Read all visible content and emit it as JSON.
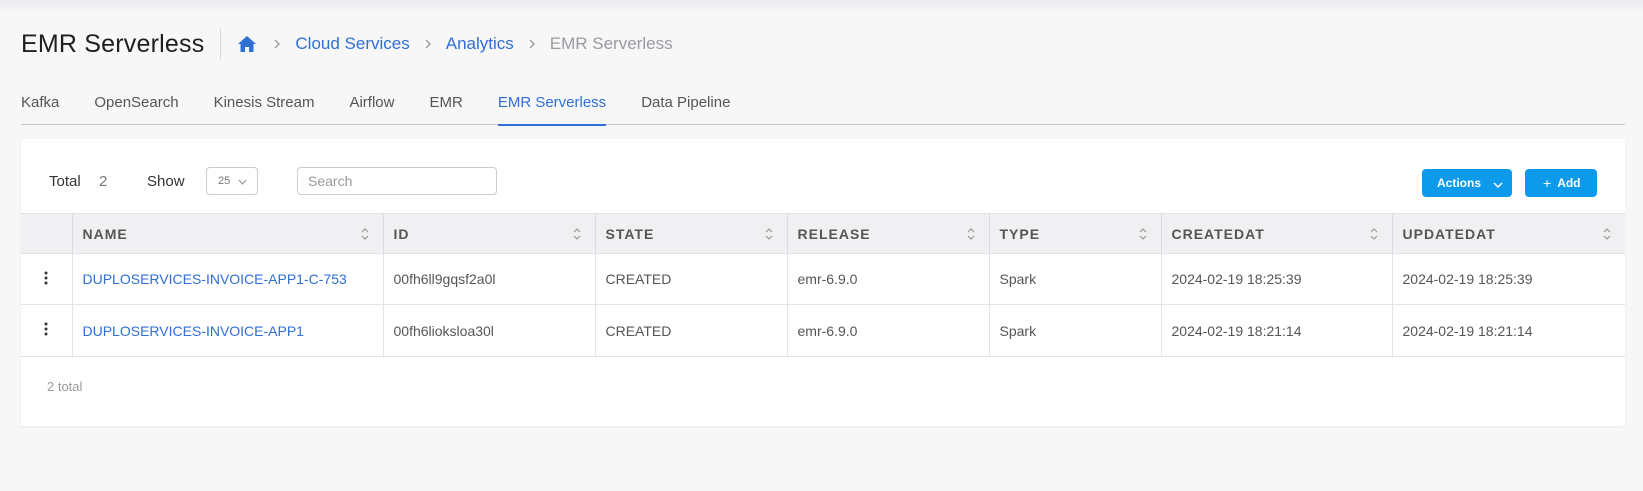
{
  "header": {
    "title": "EMR Serverless",
    "breadcrumb": {
      "home_icon": "home-icon",
      "items": [
        "Cloud Services",
        "Analytics"
      ],
      "current": "EMR Serverless"
    }
  },
  "tabs": [
    {
      "label": "Kafka",
      "active": false
    },
    {
      "label": "OpenSearch",
      "active": false
    },
    {
      "label": "Kinesis Stream",
      "active": false
    },
    {
      "label": "Airflow",
      "active": false
    },
    {
      "label": "EMR",
      "active": false
    },
    {
      "label": "EMR Serverless",
      "active": true
    },
    {
      "label": "Data Pipeline",
      "active": false
    }
  ],
  "toolbar": {
    "total_label": "Total",
    "total_value": "2",
    "show_label": "Show",
    "show_value": "25",
    "search_placeholder": "Search",
    "actions_label": "Actions",
    "add_label": "Add"
  },
  "table": {
    "columns": [
      "NAME",
      "ID",
      "STATE",
      "RELEASE",
      "TYPE",
      "CREATEDAT",
      "UPDATEDAT"
    ],
    "rows": [
      {
        "name": "DUPLOSERVICES-INVOICE-APP1-C-753",
        "id": "00fh6ll9gqsf2a0l",
        "state": "CREATED",
        "release": "emr-6.9.0",
        "type": "Spark",
        "createdat": "2024-02-19 18:25:39",
        "updatedat": "2024-02-19 18:25:39"
      },
      {
        "name": "DUPLOSERVICES-INVOICE-APP1",
        "id": "00fh6lioksloa30l",
        "state": "CREATED",
        "release": "emr-6.9.0",
        "type": "Spark",
        "createdat": "2024-02-19 18:21:14",
        "updatedat": "2024-02-19 18:21:14"
      }
    ]
  },
  "footer": {
    "total_text": "2 total"
  },
  "colors": {
    "accent": "#2f6fd6",
    "button": "#0d9aea",
    "header_bg": "#f0f0f3"
  }
}
